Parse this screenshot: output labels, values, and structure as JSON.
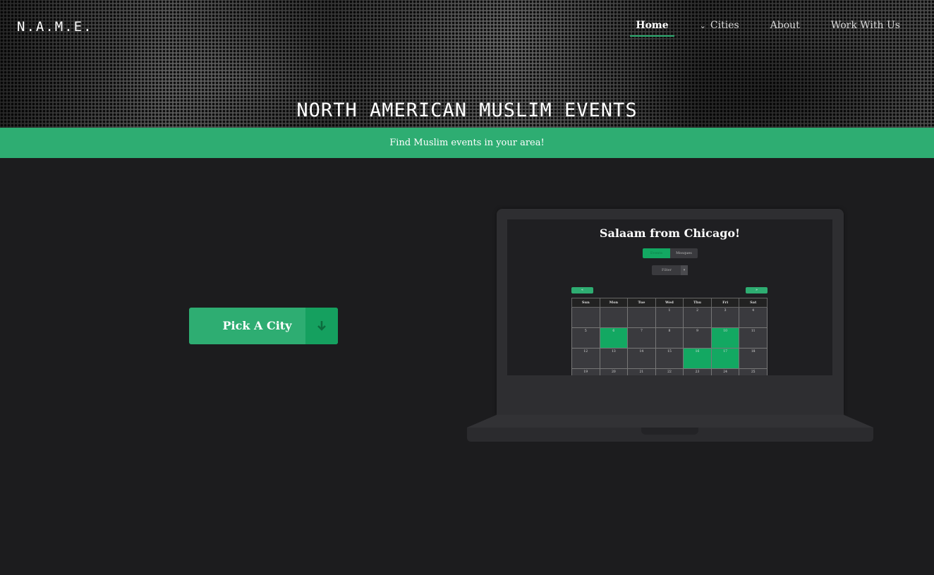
{
  "header": {
    "brand": "N.A.M.E.",
    "nav": [
      {
        "label": "Home",
        "active": true
      },
      {
        "label": "Cities",
        "has_dropdown": true
      },
      {
        "label": "About"
      },
      {
        "label": "Work With Us"
      }
    ]
  },
  "hero": {
    "title": "NORTH AMERICAN MUSLIM EVENTS"
  },
  "banner": {
    "text": "Find Muslim events in your area!"
  },
  "cta": {
    "label": "Pick A City",
    "icon": "arrow-down-icon"
  },
  "preview": {
    "title": "Salaam from Chicago!",
    "tabs": [
      "Events",
      "Mosques"
    ],
    "filter": "Filter",
    "prev": "«",
    "next": "»",
    "weekdays": [
      "Sun",
      "Mon",
      "Tue",
      "Wed",
      "Thu",
      "Fri",
      "Sat"
    ],
    "weeks": [
      [
        "",
        "",
        "",
        "1",
        "2",
        "3",
        "4"
      ],
      [
        "5",
        "6",
        "7",
        "8",
        "9",
        "10",
        "11"
      ],
      [
        "12",
        "13",
        "14",
        "15",
        "16",
        "17",
        "18"
      ],
      [
        "19",
        "20",
        "21",
        "22",
        "23",
        "24",
        "25"
      ]
    ],
    "highlighted": [
      "6",
      "10",
      "16",
      "17"
    ]
  },
  "colors": {
    "accent": "#2ead72",
    "accent_dark": "#15a05f",
    "background": "#1c1c1e"
  }
}
